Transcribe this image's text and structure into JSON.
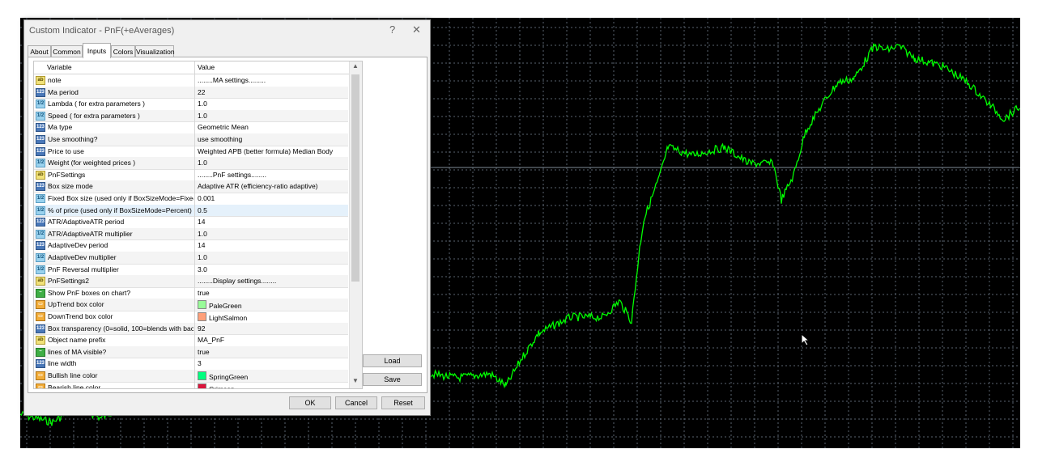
{
  "dialog": {
    "title": "Custom Indicator - PnF(+eAverages)",
    "help_label": "?",
    "close_label": "✕",
    "tabs": [
      {
        "label": "About"
      },
      {
        "label": "Common"
      },
      {
        "label": "Inputs"
      },
      {
        "label": "Colors"
      },
      {
        "label": "Visualization"
      }
    ],
    "active_tab": "Inputs",
    "grid": {
      "col_variable": "Variable",
      "col_value": "Value",
      "rows": [
        {
          "type": "abc",
          "name": "note",
          "value": "........MA settings........."
        },
        {
          "type": "int",
          "name": "Ma period",
          "value": "22"
        },
        {
          "type": "dbl",
          "name": "Lambda  ( for extra parameters )",
          "value": "1.0"
        },
        {
          "type": "dbl",
          "name": "Speed  ( for extra parameters )",
          "value": "1.0"
        },
        {
          "type": "int",
          "name": "Ma type",
          "value": "Geometric Mean"
        },
        {
          "type": "int",
          "name": "Use smoothing?",
          "value": "use smoothing"
        },
        {
          "type": "int",
          "name": "Price to use",
          "value": "Weighted APB (better formula) Median Body"
        },
        {
          "type": "dbl",
          "name": "Weight  (for weighted prices )",
          "value": "1.0"
        },
        {
          "type": "abc",
          "name": "PnFSettings",
          "value": "........PnF settings........"
        },
        {
          "type": "int",
          "name": "Box size mode",
          "value": "Adaptive ATR (efficiency-ratio adaptive)"
        },
        {
          "type": "dbl",
          "name": "Fixed Box size (used only if BoxSizeMode=Fixed)",
          "value": "0.001"
        },
        {
          "type": "dbl",
          "name": "% of price (used only if BoxSizeMode=Percent)",
          "value": "0.5"
        },
        {
          "type": "int",
          "name": "ATR/AdaptiveATR period",
          "value": "14"
        },
        {
          "type": "dbl",
          "name": "ATR/AdaptiveATR multiplier",
          "value": "1.0"
        },
        {
          "type": "int",
          "name": "AdaptiveDev period",
          "value": "14"
        },
        {
          "type": "dbl",
          "name": "AdaptiveDev multiplier",
          "value": "1.0"
        },
        {
          "type": "dbl",
          "name": "PnF Reversal multiplier",
          "value": "3.0"
        },
        {
          "type": "abc",
          "name": "PnFSettings2",
          "value": "........Display settings........"
        },
        {
          "type": "bool",
          "name": "Show PnF boxes on chart?",
          "value": "true"
        },
        {
          "type": "clr",
          "name": "UpTrend box color",
          "value": "PaleGreen",
          "color": "#98fb98"
        },
        {
          "type": "clr",
          "name": "DownTrend box color",
          "value": "LightSalmon",
          "color": "#ffa07a"
        },
        {
          "type": "int",
          "name": "Box transparency (0=solid, 100=blends with bac...",
          "value": "92"
        },
        {
          "type": "abc",
          "name": "Object name prefix",
          "value": "MA_PnF"
        },
        {
          "type": "bool",
          "name": "lines of MA visible?",
          "value": "true"
        },
        {
          "type": "int",
          "name": "line width",
          "value": "3"
        },
        {
          "type": "clr",
          "name": "Bullish  line  color",
          "value": "SpringGreen",
          "color": "#00ff7f"
        },
        {
          "type": "clr",
          "name": "Bearish  line  color",
          "value": "Crimson",
          "color": "#dc143c"
        }
      ]
    },
    "buttons": {
      "load": "Load",
      "save": "Save",
      "ok": "OK",
      "cancel": "Cancel",
      "reset": "Reset"
    }
  },
  "icons": {
    "abc": "ab",
    "int": "123",
    "dbl": "1/2",
    "bool": "~",
    "clr": "▭"
  },
  "colors": {
    "chart_bg": "#000000",
    "price_line": "#00ff00",
    "grid": "#5a6470",
    "selected_row": "#e5f1fb"
  }
}
